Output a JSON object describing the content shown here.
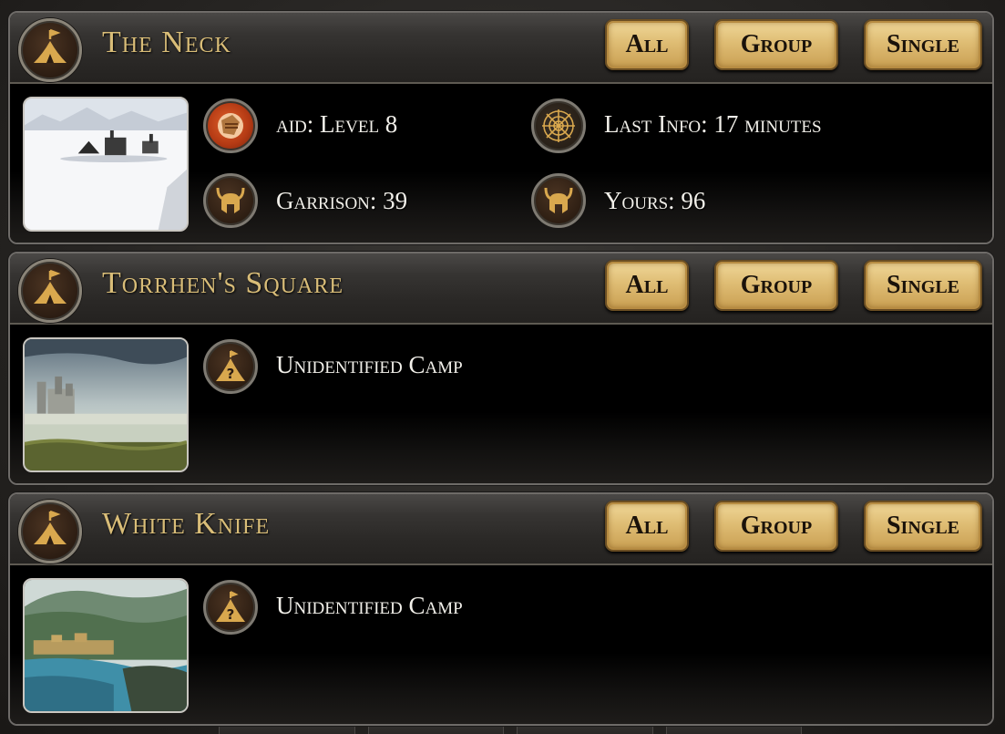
{
  "camps": [
    {
      "name": "The Neck",
      "buttons": {
        "all": "All",
        "group": "Group",
        "single": "Single"
      },
      "image": "snowy-camp-scene",
      "status": "identified",
      "info": {
        "aid": "aid: Level 8",
        "last_info": "Last Info: 17 minutes",
        "garrison": "Garrison: 39",
        "yours": "Yours: 96"
      }
    },
    {
      "name": "Torrhen's Square",
      "buttons": {
        "all": "All",
        "group": "Group",
        "single": "Single"
      },
      "image": "castle-by-lake-scene",
      "status": "unidentified",
      "status_text": "Unidentified Camp"
    },
    {
      "name": "White Knife",
      "buttons": {
        "all": "All",
        "group": "Group",
        "single": "Single"
      },
      "image": "river-town-scene",
      "status": "unidentified",
      "status_text": "Unidentified Camp"
    }
  ],
  "icons": {
    "camp": "camp-tent-icon",
    "aid": "aid-fist-icon",
    "last_info": "spider-web-icon",
    "garrison": "horned-helmet-icon",
    "yours": "horned-helmet-icon",
    "unidentified": "unidentified-camp-icon"
  },
  "colors": {
    "title_gold": "#d9bd78",
    "button_gold": "#dfbd74",
    "text_light": "#f2f0ea",
    "panel_black": "#000000"
  }
}
